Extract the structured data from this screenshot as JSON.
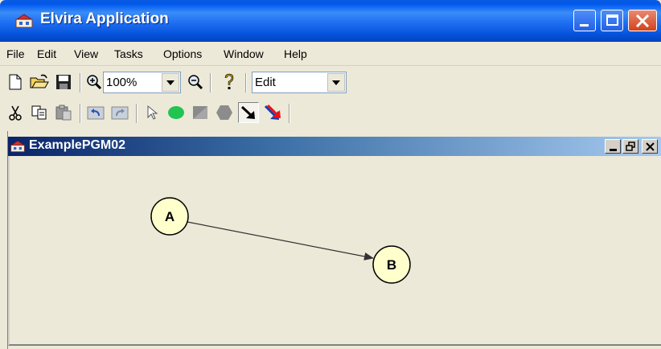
{
  "window": {
    "title": "Elvira Application"
  },
  "menu": [
    "File",
    "Edit",
    "View",
    "Tasks",
    "Options",
    "Window",
    "Help"
  ],
  "toolbar": {
    "zoom_value": "100%",
    "mode_value": "Edit",
    "row1_icons": [
      "new-file-icon",
      "open-folder-icon",
      "save-icon",
      "zoom-in-icon",
      "zoom-out-icon",
      "help-icon"
    ],
    "row2_icons": [
      "cut-icon",
      "copy-icon",
      "paste-icon",
      "undo-icon",
      "redo-icon",
      "pointer-icon",
      "chance-node-icon",
      "decision-node-icon",
      "utility-node-icon",
      "arrow-link-icon",
      "delete-link-icon"
    ]
  },
  "internal_frame": {
    "title": "ExamplePGM02"
  },
  "graph": {
    "nodes": [
      {
        "id": "A",
        "label": "A"
      },
      {
        "id": "B",
        "label": "B"
      }
    ],
    "edges": [
      {
        "from": "A",
        "to": "B"
      }
    ],
    "node_fill": "#ffffcc"
  },
  "colors": {
    "titlebar": "#0058ee",
    "close": "#d2421d",
    "frame_title": "#0a246a"
  }
}
